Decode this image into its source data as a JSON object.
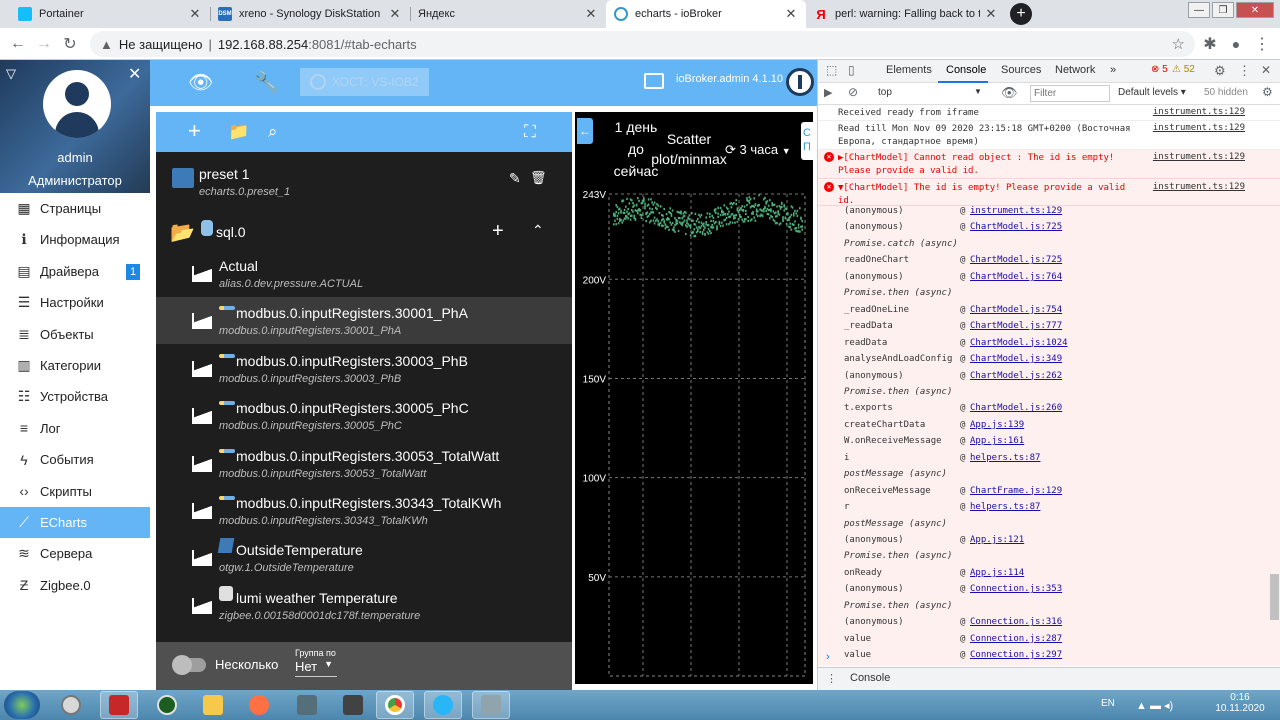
{
  "browser": {
    "tabs": [
      {
        "title": "Portainer",
        "icon": "portainer-icon",
        "color": "#13bef9"
      },
      {
        "title": "xreno - Synology DiskStation",
        "icon": "dsm-icon",
        "color": "#2a6ebb"
      },
      {
        "title": "Яндекс",
        "icon": "yandex-icon",
        "color": "#ffffff"
      },
      {
        "title": "echarts - ioBroker",
        "icon": "iobroker-icon",
        "color": "#3399cc"
      },
      {
        "title": "perl: warning: Falling back to the",
        "icon": "yandex-search-icon",
        "color": "#ff0000"
      }
    ],
    "address": {
      "security": "Не защищено",
      "host": "192.168.88.254",
      "rest": ":8081/#tab-echarts"
    }
  },
  "sidebar": {
    "user_name": "admin",
    "user_role": "Администратор",
    "items": [
      {
        "label": "Страницы",
        "icon": "grid-icon"
      },
      {
        "label": "Информация",
        "icon": "info-icon"
      },
      {
        "label": "Драйвера",
        "icon": "store-icon",
        "badge": "1"
      },
      {
        "label": "Настройки",
        "icon": "settings-list-icon"
      },
      {
        "label": "Объекты",
        "icon": "list-icon"
      },
      {
        "label": "Категории",
        "icon": "categories-icon"
      },
      {
        "label": "Устройства",
        "icon": "devices-icon"
      },
      {
        "label": "Лог",
        "icon": "log-icon"
      },
      {
        "label": "События",
        "icon": "flash-icon"
      },
      {
        "label": "Скрипты",
        "icon": "code-icon"
      },
      {
        "label": "ECharts",
        "icon": "chart-icon",
        "selected": true
      },
      {
        "label": "Сервера",
        "icon": "servers-icon"
      },
      {
        "label": "Zigbee.0",
        "icon": "zigbee-icon"
      }
    ]
  },
  "appbar": {
    "host_label": "ХОСТ: VS-IOB2",
    "admin_version": "ioBroker.admin 4.1.10"
  },
  "tree": {
    "preset": {
      "title": "preset 1",
      "sub": "echarts.0.preset_1"
    },
    "folder": {
      "title": "sql.0"
    },
    "items": [
      {
        "title": "Actual",
        "sub": "alias.0.dev.pressure.ACTUAL"
      },
      {
        "title": "modbus.0.inputRegisters.30001_PhA",
        "sub": "modbus.0.inputRegisters.30001_PhA"
      },
      {
        "title": "modbus.0.inputRegisters.30003_PhB",
        "sub": "modbus.0.inputRegisters.30003_PhB"
      },
      {
        "title": "modbus.0.inputRegisters.30005_PhC",
        "sub": "modbus.0.inputRegisters.30005_PhC"
      },
      {
        "title": "modbus.0.inputRegisters.30053_TotalWatt",
        "sub": "modbus.0.inputRegisters.30053_TotalWatt"
      },
      {
        "title": "modbus.0.inputRegisters.30343_TotalKWh",
        "sub": "modbus.0.inputRegisters.30343_TotalKWh"
      },
      {
        "title": "OutsideTemperature",
        "sub": "otgw.1.OutsideTemperature"
      },
      {
        "title": "lumi weather Temperature",
        "sub": "zigbee.0.00158d0001dc178f.temperature"
      }
    ],
    "footer": {
      "toggle_label": "Несколько",
      "group_label": "Группа по",
      "group_value": "Нет"
    }
  },
  "chart": {
    "range_line1": "1 день",
    "range_line2": "до",
    "range_line3": "сейчас",
    "type_line1": "Scatter",
    "type_line2": "plot/minmax",
    "refresh_label": "3 часа",
    "side_tab": "C П"
  },
  "chart_data": {
    "type": "scatter",
    "y_ticks": [
      "243V",
      "200V",
      "150V",
      "100V",
      "50V"
    ],
    "ylim": [
      0,
      243
    ],
    "series_color": "#4caf7a",
    "band": {
      "min": 225,
      "max": 240
    }
  },
  "devtools": {
    "tabs": [
      "Elements",
      "Console",
      "Sources",
      "Network"
    ],
    "errors": "5",
    "warnings": "52",
    "context": "top",
    "filter_placeholder": "Filter",
    "levels": "Default levels ▾",
    "hidden": "50 hidden",
    "logs": [
      {
        "text": "Received ready from iframe",
        "src": "instrument.ts:129",
        "type": "info"
      },
      {
        "text": "Read till Mon Nov 09 2020 23:15:18 GMT+0200 (Восточная Европа, стандартное время)",
        "src": "instrument.ts:129",
        "type": "info"
      },
      {
        "text": "▶[ChartModel] Cannot read object : The id is empty! Please provide a valid id.",
        "src": "instrument.ts:129",
        "type": "err"
      },
      {
        "text": "▼[ChartModel] The id is empty! Please provide a valid id.",
        "src": "instrument.ts:129",
        "type": "err"
      }
    ],
    "stack": [
      {
        "fn": "(anonymous)",
        "link": "instrument.ts:129"
      },
      {
        "fn": "(anonymous)",
        "link": "ChartModel.js:725"
      },
      {
        "fn": "Promise.catch (async)",
        "link": ""
      },
      {
        "fn": "readOneChart",
        "link": "ChartModel.js:725"
      },
      {
        "fn": "(anonymous)",
        "link": "ChartModel.js:764"
      },
      {
        "fn": "Promise.then (async)",
        "link": ""
      },
      {
        "fn": "_readOneLine",
        "link": "ChartModel.js:754"
      },
      {
        "fn": "_readData",
        "link": "ChartModel.js:777"
      },
      {
        "fn": "readData",
        "link": "ChartModel.js:1024"
      },
      {
        "fn": "analyseAndLoadConfig",
        "link": "ChartModel.js:349"
      },
      {
        "fn": "(anonymous)",
        "link": "ChartModel.js:262"
      },
      {
        "fn": "Promise.then (async)",
        "link": ""
      },
      {
        "fn": "t.exports",
        "link": "ChartModel.js:260"
      },
      {
        "fn": "createChartData",
        "link": "App.js:139"
      },
      {
        "fn": "W.onReceiveMessage",
        "link": "App.js:161"
      },
      {
        "fn": "i",
        "link": "helpers.ts:87"
      },
      {
        "fn": "postMessage (async)",
        "link": ""
      },
      {
        "fn": "onReceiveMessage",
        "link": "ChartFrame.js:129"
      },
      {
        "fn": "r",
        "link": "helpers.ts:87"
      },
      {
        "fn": "postMessage (async)",
        "link": ""
      },
      {
        "fn": "(anonymous)",
        "link": "App.js:121"
      },
      {
        "fn": "Promise.then (async)",
        "link": ""
      },
      {
        "fn": "onReady",
        "link": "App.js:114"
      },
      {
        "fn": "(anonymous)",
        "link": "Connection.js:353"
      },
      {
        "fn": "Promise.then (async)",
        "link": ""
      },
      {
        "fn": "(anonymous)",
        "link": "Connection.js:316"
      },
      {
        "fn": "value",
        "link": "Connection.js:287"
      },
      {
        "fn": "value",
        "link": "Connection.js:297"
      }
    ],
    "drawer_tab": "Console"
  },
  "taskbar": {
    "apps": [
      "start",
      "explorer-ie",
      "winscp",
      "drive",
      "folder",
      "firefox",
      "game",
      "chrome",
      "telegram",
      "putty"
    ],
    "lang": "EN",
    "time": "0:16",
    "date": "10.11.2020"
  }
}
